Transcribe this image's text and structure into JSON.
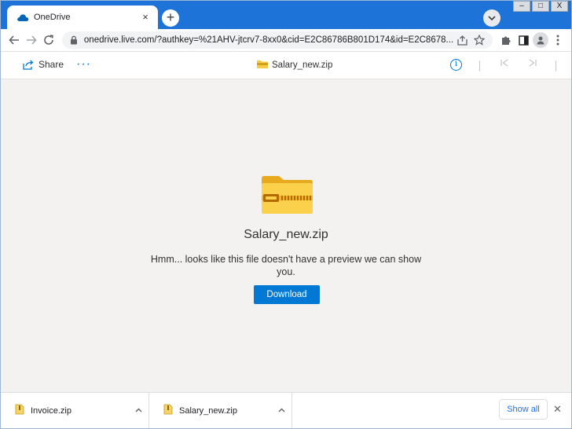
{
  "window": {
    "tab_title": "OneDrive",
    "tab_close": "×",
    "new_tab": "+",
    "minimize": "–",
    "maximize": "□",
    "close": "X"
  },
  "toolbar": {
    "url": "onedrive.live.com/?authkey=%21AHV-jtcrv7-8xx0&cid=E2C86786B801D174&id=E2C8678..."
  },
  "commandbar": {
    "share_label": "Share",
    "more_label": "···",
    "file_name": "Salary_new.zip",
    "info_label": "i"
  },
  "preview": {
    "file_name": "Salary_new.zip",
    "message": "Hmm... looks like this file doesn't have a preview we can show you.",
    "download_label": "Download"
  },
  "downloads": {
    "items": [
      {
        "name": "Invoice.zip"
      },
      {
        "name": "Salary_new.zip"
      }
    ],
    "show_all": "Show all",
    "close": "✕"
  },
  "colors": {
    "accent": "#0078d4",
    "titlebar": "#1e73d8",
    "folder": "#f7c948"
  }
}
